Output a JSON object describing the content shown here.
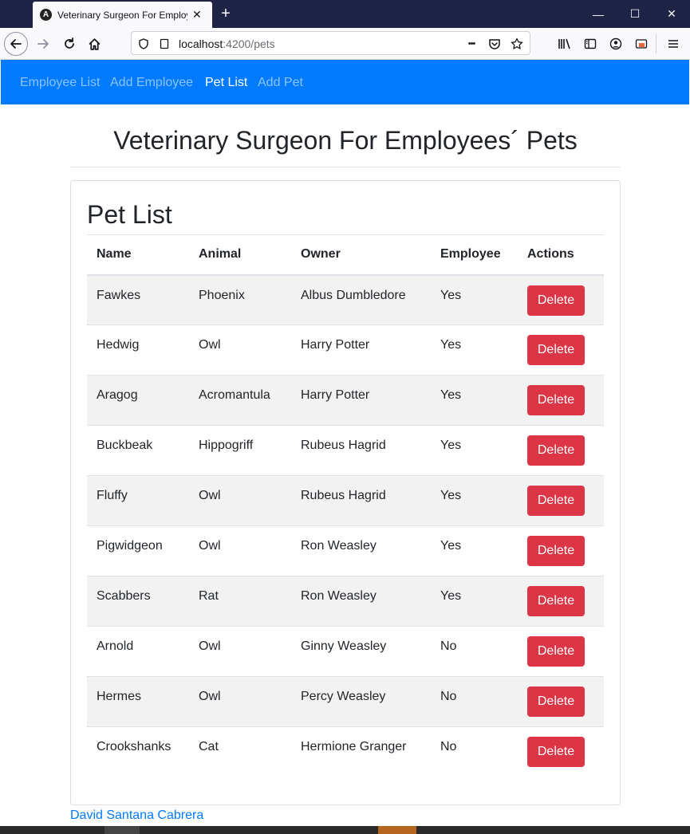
{
  "browser": {
    "tab_title": "Veterinary Surgeon For Employees´ Pets",
    "tab_favicon": "A",
    "url_host": "localhost",
    "url_path": ":4200/pets",
    "new_tab_symbol": "+",
    "close_symbol": "✕",
    "minimize_symbol": "—",
    "maximize_symbol": "☐",
    "window_close_symbol": "✕",
    "url_more_symbol": "•••"
  },
  "nav": {
    "items": [
      {
        "label": "Employee List",
        "active": false
      },
      {
        "label": "Add Employee",
        "active": false
      },
      {
        "label": "Pet List",
        "active": true
      },
      {
        "label": "Add Pet",
        "active": false
      }
    ]
  },
  "page": {
    "title": "Veterinary Surgeon For Employees´ Pets",
    "card_title": "Pet List"
  },
  "table": {
    "headers": [
      "Name",
      "Animal",
      "Owner",
      "Employee",
      "Actions"
    ],
    "action_label": "Delete",
    "rows": [
      {
        "name": "Fawkes",
        "animal": "Phoenix",
        "owner": "Albus Dumbledore",
        "employee": "Yes"
      },
      {
        "name": "Hedwig",
        "animal": "Owl",
        "owner": "Harry Potter",
        "employee": "Yes"
      },
      {
        "name": "Aragog",
        "animal": "Acromantula",
        "owner": "Harry Potter",
        "employee": "Yes"
      },
      {
        "name": "Buckbeak",
        "animal": "Hippogriff",
        "owner": "Rubeus Hagrid",
        "employee": "Yes"
      },
      {
        "name": "Fluffy",
        "animal": "Owl",
        "owner": "Rubeus Hagrid",
        "employee": "Yes"
      },
      {
        "name": "Pigwidgeon",
        "animal": "Owl",
        "owner": "Ron Weasley",
        "employee": "Yes"
      },
      {
        "name": "Scabbers",
        "animal": "Rat",
        "owner": "Ron Weasley",
        "employee": "Yes"
      },
      {
        "name": "Arnold",
        "animal": "Owl",
        "owner": "Ginny Weasley",
        "employee": "No"
      },
      {
        "name": "Hermes",
        "animal": "Owl",
        "owner": "Percy Weasley",
        "employee": "No"
      },
      {
        "name": "Crookshanks",
        "animal": "Cat",
        "owner": "Hermione Granger",
        "employee": "No"
      }
    ]
  },
  "footer": {
    "author": "David Santana Cabrera"
  },
  "colors": {
    "primary": "#007bff",
    "danger": "#dc3545",
    "titlebar": "#1f2447"
  }
}
